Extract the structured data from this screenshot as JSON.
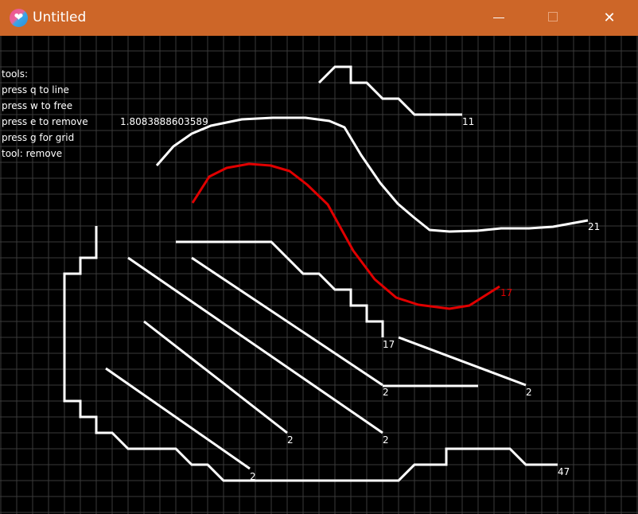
{
  "window": {
    "title": "Untitled",
    "icon": "heart-app-icon",
    "titlebar_color": "#cd6628",
    "controls": {
      "minimize_icon": "minimize-icon",
      "maximize_icon": "maximize-icon",
      "close_icon": "close-icon",
      "close_glyph": "✕",
      "heart_glyph": "❤"
    }
  },
  "hud": {
    "title": "tools:",
    "line_hint": "press q to line",
    "free_hint": "press w to free",
    "remove_hint": "press e to remove",
    "grid_hint": "press g for grid",
    "tool_status": "tool: remove",
    "readout": "1.8083888603589"
  },
  "canvas": {
    "background": "#000000",
    "grid_color": "#3a3a3a",
    "stroke_color": "#ffffff",
    "highlight_color": "#e00000",
    "stroke_labels": {
      "top_step_line": "11",
      "long_curve": "21",
      "red_curve": "17",
      "middle_step_line": "17",
      "diag_upper_right": "2",
      "diag_upper_left": "2",
      "diag_left_short": "2",
      "diag_lower_left": "2",
      "diag_center": "2",
      "outer_border": "47"
    }
  }
}
